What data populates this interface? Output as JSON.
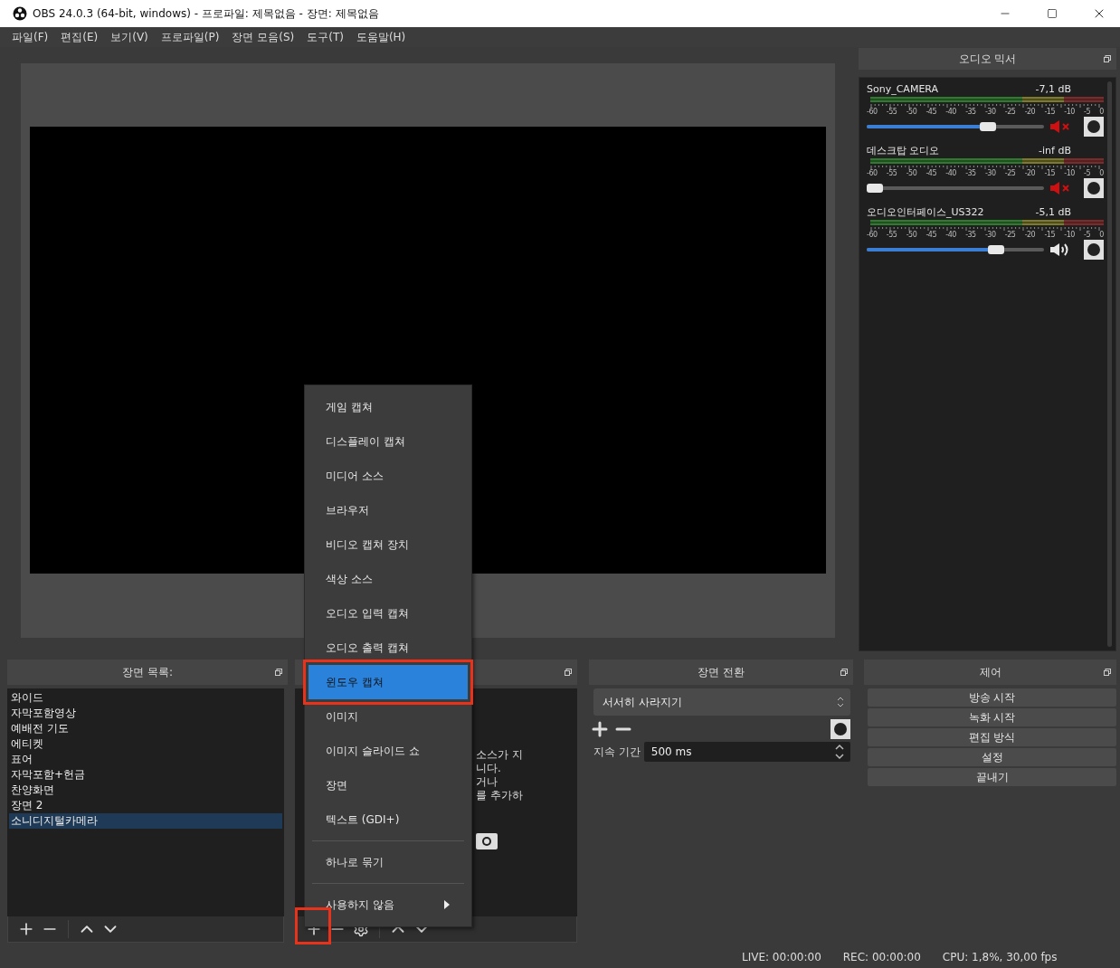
{
  "window": {
    "title": "OBS 24.0.3 (64-bit, windows) - 프로파일: 제목없음 - 장면: 제목없음"
  },
  "menu": [
    "파일(F)",
    "편집(E)",
    "보기(V)",
    "프로파일(P)",
    "장면 모음(S)",
    "도구(T)",
    "도움말(H)"
  ],
  "audio_mixer": {
    "title": "오디오 믹서",
    "channels": [
      {
        "name": "Sony_CAMERA",
        "reading": "-7,1 dB",
        "level": 0.7,
        "muted": true,
        "scale": [
          "-60",
          "-55",
          "-50",
          "-45",
          "-40",
          "-35",
          "-30",
          "-25",
          "-20",
          "-15",
          "-10",
          "-5",
          "0"
        ]
      },
      {
        "name": "데스크탑 오디오",
        "reading": "-inf dB",
        "level": 0.0,
        "muted": true,
        "scale": [
          "-60",
          "-55",
          "-50",
          "-45",
          "-40",
          "-35",
          "-30",
          "-25",
          "-20",
          "-15",
          "-10",
          "-5",
          "0"
        ]
      },
      {
        "name": "오디오인터페이스_US322",
        "reading": "-5,1 dB",
        "level": 0.75,
        "muted": false,
        "scale": [
          "-60",
          "-55",
          "-50",
          "-45",
          "-40",
          "-35",
          "-30",
          "-25",
          "-20",
          "-15",
          "-10",
          "-5",
          "0"
        ]
      }
    ]
  },
  "scenes": {
    "title": "장면 목록:",
    "items": [
      {
        "label": "와이드",
        "selected": false
      },
      {
        "label": "자막포함영상",
        "selected": false
      },
      {
        "label": "예배전 기도",
        "selected": false
      },
      {
        "label": "에티켓",
        "selected": false
      },
      {
        "label": "표어",
        "selected": false
      },
      {
        "label": "자막포함+헌금",
        "selected": false
      },
      {
        "label": "찬양화면",
        "selected": false
      },
      {
        "label": "장면 2",
        "selected": false
      },
      {
        "label": "소니디지털카메라",
        "selected": true
      }
    ]
  },
  "sources": {
    "hint_fragments": [
      "소스가 지",
      "니다.",
      "거나",
      "를 추가하"
    ]
  },
  "context_menu": {
    "groups": [
      [
        {
          "label": "게임 캡쳐",
          "selected": false,
          "kind": "action"
        },
        {
          "label": "디스플레이 캡쳐",
          "selected": false,
          "kind": "action"
        },
        {
          "label": "미디어 소스",
          "selected": false,
          "kind": "action"
        },
        {
          "label": "브라우저",
          "selected": false,
          "kind": "action"
        },
        {
          "label": "비디오 캡쳐 장치",
          "selected": false,
          "kind": "action"
        },
        {
          "label": "색상 소스",
          "selected": false,
          "kind": "action"
        },
        {
          "label": "오디오 입력 캡쳐",
          "selected": false,
          "kind": "action"
        },
        {
          "label": "오디오 출력 캡쳐",
          "selected": false,
          "kind": "action"
        },
        {
          "label": "윈도우 캡쳐",
          "selected": true,
          "kind": "action"
        },
        {
          "label": "이미지",
          "selected": false,
          "kind": "action"
        },
        {
          "label": "이미지 슬라이드 쇼",
          "selected": false,
          "kind": "action"
        },
        {
          "label": "장면",
          "selected": false,
          "kind": "action"
        },
        {
          "label": "텍스트 (GDI+)",
          "selected": false,
          "kind": "action"
        }
      ],
      [
        {
          "label": "하나로 묶기",
          "selected": false,
          "kind": "action"
        }
      ],
      [
        {
          "label": "사용하지 않음",
          "selected": false,
          "kind": "submenu"
        }
      ]
    ]
  },
  "transitions": {
    "title": "장면 전환",
    "selected": "서서히 사라지기",
    "duration_label": "지속 기간",
    "duration": "500 ms"
  },
  "controls": {
    "title": "제어",
    "buttons": [
      "방송 시작",
      "녹화 시작",
      "편집 방식",
      "설정",
      "끝내기"
    ]
  },
  "status_bar": {
    "live": "LIVE: 00:00:00",
    "rec": "REC: 00:00:00",
    "cpu": "CPU: 1,8%, 30,00 fps"
  }
}
